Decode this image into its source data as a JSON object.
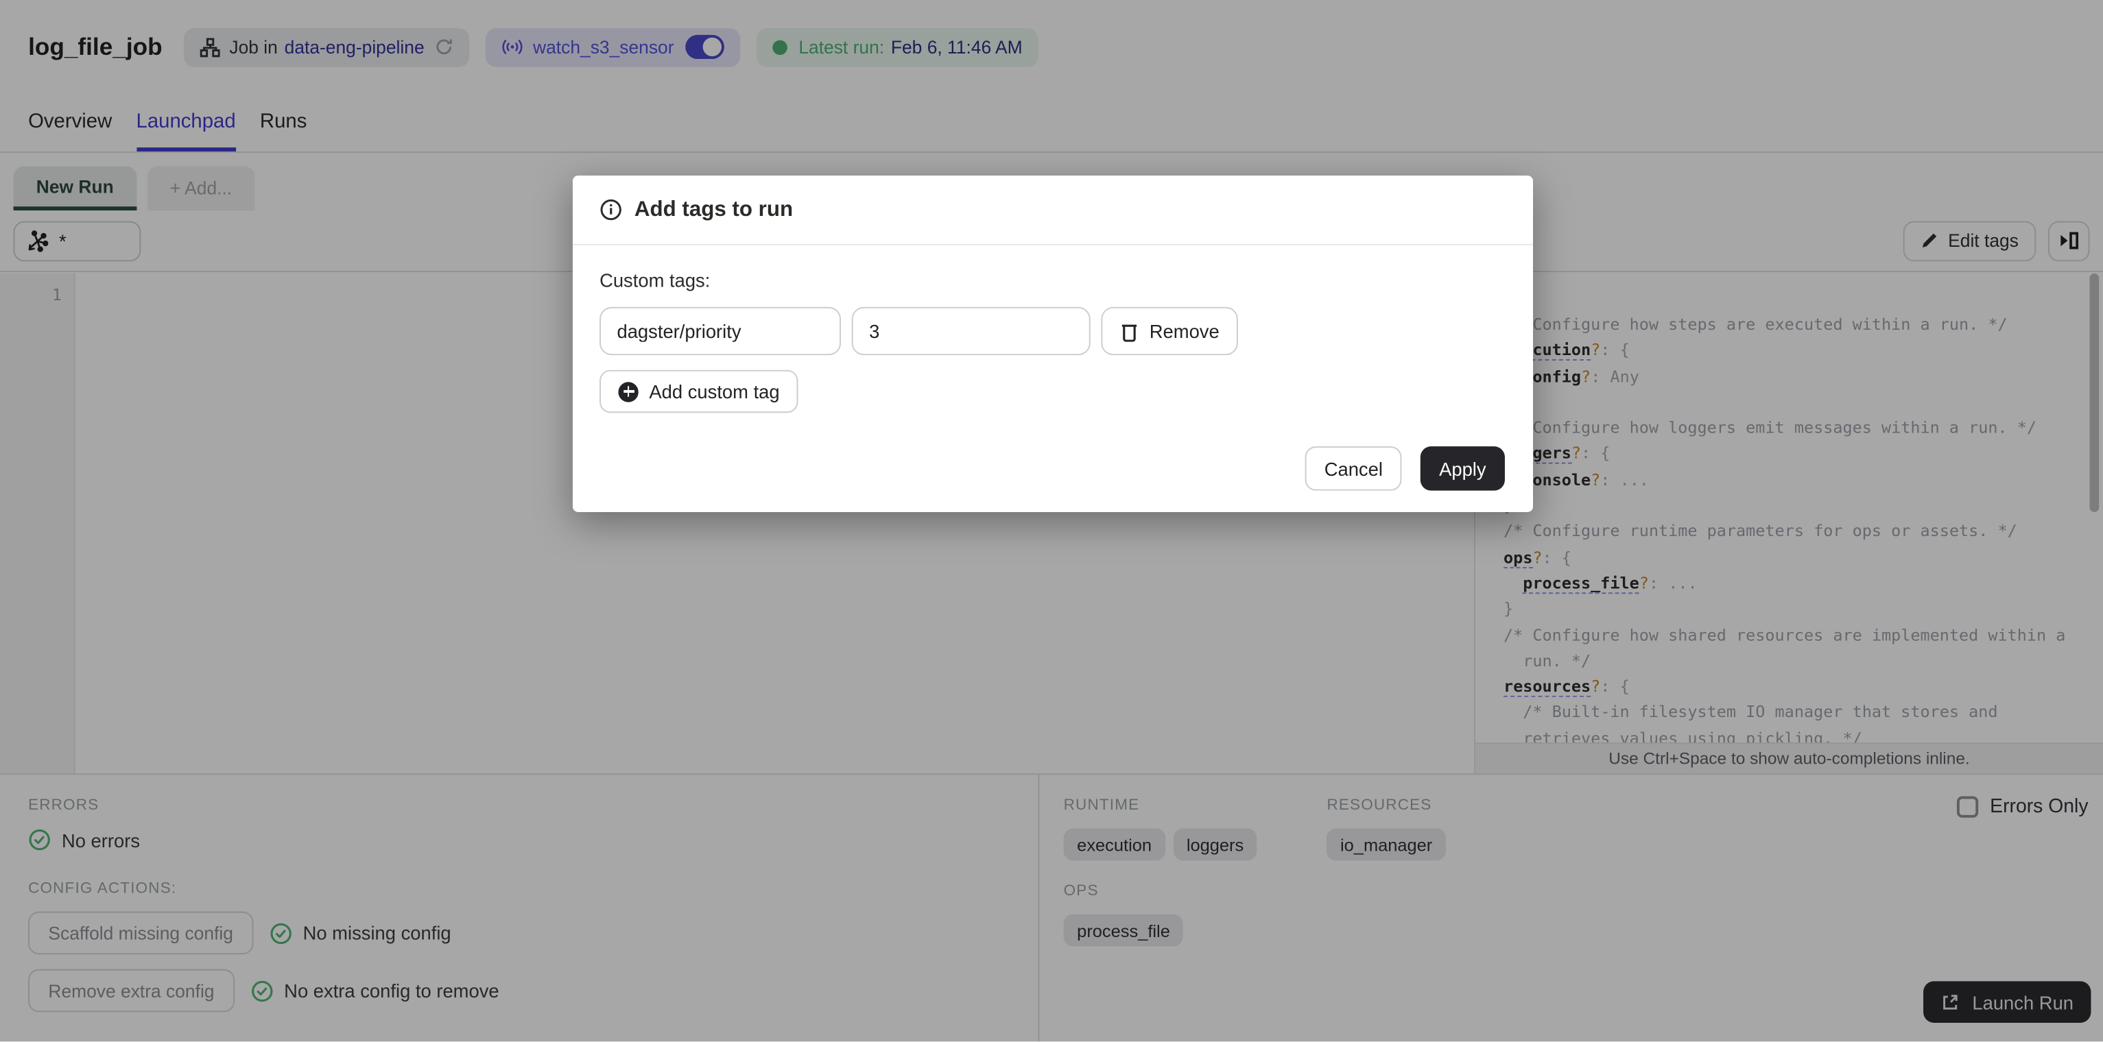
{
  "header": {
    "title": "log_file_job",
    "job_badge": {
      "prefix": "Job in",
      "link": "data-eng-pipeline"
    },
    "sensor_badge": {
      "label": "watch_s3_sensor",
      "state": "on"
    },
    "latest_run_badge": {
      "label": "Latest run:",
      "value": "Feb 6, 11:46 AM"
    },
    "tabs": [
      {
        "label": "Overview",
        "active": false
      },
      {
        "label": "Launchpad",
        "active": true
      },
      {
        "label": "Runs",
        "active": false
      }
    ]
  },
  "launchpad": {
    "config_tabs": [
      {
        "label": "New Run",
        "active": true
      },
      {
        "label": "+ Add...",
        "active": false
      }
    ],
    "op_selector_value": "*",
    "edit_tags_label": "Edit tags",
    "editor_line_number": "1",
    "hint": "Use Ctrl+Space to show auto-completions inline."
  },
  "schema_panel": {
    "lines": [
      [
        {
          "c": "cm",
          "t": "/* Configure how steps are executed within a run. */"
        }
      ],
      [
        {
          "c": "kw",
          "t": "execution"
        },
        {
          "c": "q",
          "t": "?"
        },
        {
          "c": "pu",
          "t": ": {"
        }
      ],
      [
        {
          "c": "pu",
          "t": "  "
        },
        {
          "c": "kp",
          "t": "config"
        },
        {
          "c": "q",
          "t": "?"
        },
        {
          "c": "pu",
          "t": ": "
        },
        {
          "c": "di",
          "t": "Any"
        }
      ],
      [
        {
          "c": "pu",
          "t": "}"
        }
      ],
      [
        {
          "c": "cm",
          "t": "/* Configure how loggers emit messages within a run. */"
        }
      ],
      [
        {
          "c": "kw",
          "t": "loggers"
        },
        {
          "c": "q",
          "t": "?"
        },
        {
          "c": "pu",
          "t": ": {"
        }
      ],
      [
        {
          "c": "pu",
          "t": "  "
        },
        {
          "c": "kp",
          "t": "console"
        },
        {
          "c": "q",
          "t": "?"
        },
        {
          "c": "pu",
          "t": ": "
        },
        {
          "c": "di",
          "t": "..."
        }
      ],
      [
        {
          "c": "pu",
          "t": "}"
        }
      ],
      [
        {
          "c": "cm",
          "t": "/* Configure runtime parameters for ops or assets. */"
        }
      ],
      [
        {
          "c": "kw",
          "t": "ops"
        },
        {
          "c": "q",
          "t": "?"
        },
        {
          "c": "pu",
          "t": ": {"
        }
      ],
      [
        {
          "c": "pu",
          "t": "  "
        },
        {
          "c": "kw",
          "t": "process_file"
        },
        {
          "c": "q",
          "t": "?"
        },
        {
          "c": "pu",
          "t": ": "
        },
        {
          "c": "di",
          "t": "..."
        }
      ],
      [
        {
          "c": "pu",
          "t": "}"
        }
      ],
      [
        {
          "c": "cm",
          "t": "/* Configure how shared resources are implemented within a"
        }
      ],
      [
        {
          "c": "cm",
          "t": "  run. */"
        }
      ],
      [
        {
          "c": "kw",
          "t": "resources"
        },
        {
          "c": "q",
          "t": "?"
        },
        {
          "c": "pu",
          "t": ": {"
        }
      ],
      [
        {
          "c": "cm",
          "t": "  /* Built-in filesystem IO manager that stores and"
        }
      ],
      [
        {
          "c": "cm",
          "t": "  retrieves values using pickling. */"
        }
      ]
    ]
  },
  "bottom_left": {
    "errors_label": "ERRORS",
    "no_errors": "No errors",
    "config_actions_label": "CONFIG ACTIONS:",
    "scaffold_button": "Scaffold missing config",
    "no_missing": "No missing config",
    "remove_button": "Remove extra config",
    "no_extra": "No extra config to remove"
  },
  "bottom_right": {
    "runtime_label": "RUNTIME",
    "runtime_tags": [
      "execution",
      "loggers"
    ],
    "resources_label": "RESOURCES",
    "resource_tags": [
      "io_manager"
    ],
    "ops_label": "OPS",
    "op_tags": [
      "process_file"
    ],
    "errors_only_label": "Errors Only",
    "launch_button": "Launch Run"
  },
  "modal": {
    "title": "Add tags to run",
    "custom_tags_label": "Custom tags:",
    "tag_key": "dagster/priority",
    "tag_value": "3",
    "remove_label": "Remove",
    "add_label": "Add custom tag",
    "cancel_label": "Cancel",
    "apply_label": "Apply"
  },
  "colors": {
    "accent_blurple": "#433CD0",
    "link_navy": "#32329A",
    "green": "#4FAF74",
    "active_tab_green": "#2B4F43",
    "dark_button": "#26262A",
    "overlay": "rgba(0,0,0,0.345)"
  }
}
